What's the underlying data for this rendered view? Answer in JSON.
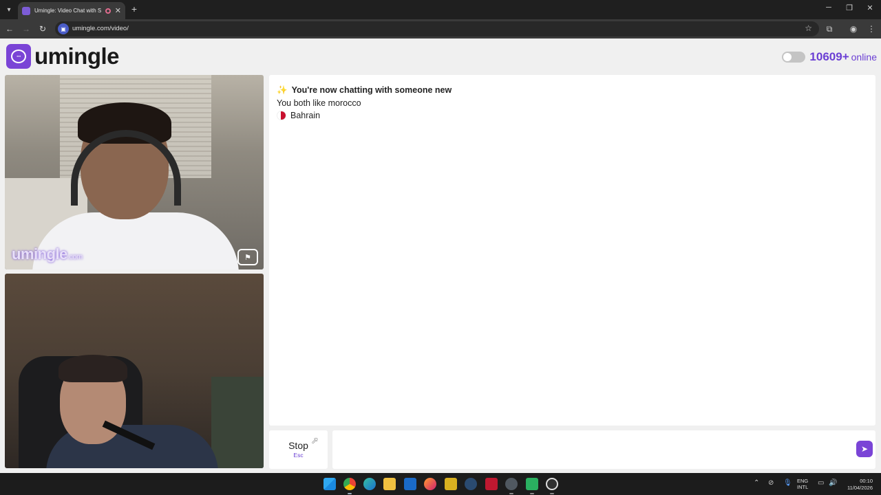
{
  "browser": {
    "tab_title": "Umingle: Video Chat with S",
    "url": "umingle.com/video/"
  },
  "site": {
    "logo_text": "umingle",
    "online_count": "10609+",
    "online_label": "online",
    "accent": "#6b3fd4"
  },
  "videos": {
    "remote_watermark": "umingle",
    "remote_watermark_suffix": ".com"
  },
  "chat": {
    "messages": [
      {
        "icon": "sparkle-icon",
        "text": "You're now chatting with someone new"
      },
      {
        "text": "You both like morocco"
      },
      {
        "icon": "bahrain-flag-icon",
        "text": "Bahrain"
      }
    ]
  },
  "controls": {
    "stop_label": "Stop",
    "stop_shortcut": "Esc",
    "message_value": ""
  },
  "taskbar": {
    "lang_top": "ENG",
    "lang_bottom": "INTL",
    "time": "00:10",
    "date": "11/04/2026"
  }
}
